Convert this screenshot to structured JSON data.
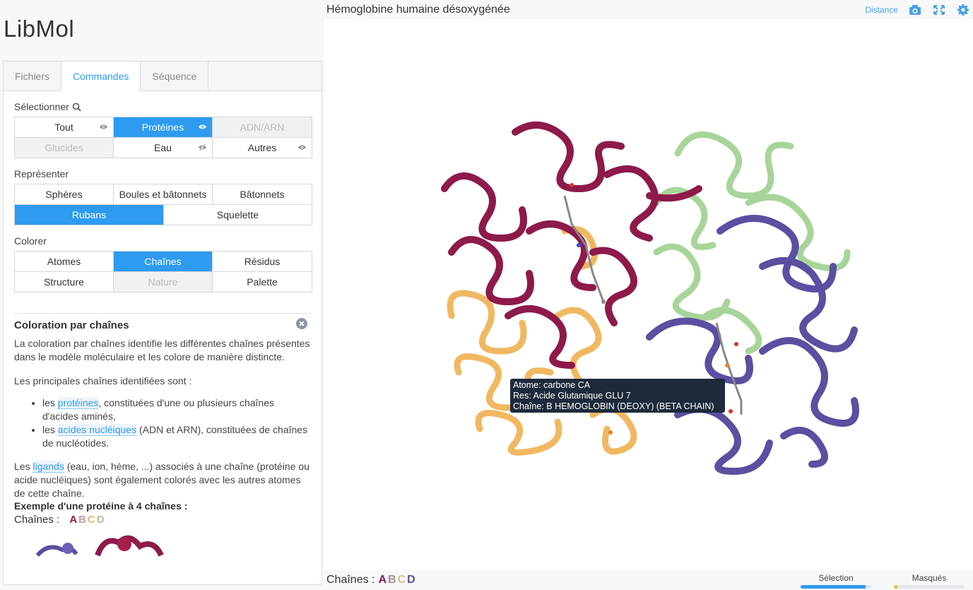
{
  "app": {
    "title": "LibMol"
  },
  "tabs": [
    {
      "label": "Fichiers",
      "active": false
    },
    {
      "label": "Commandes",
      "active": true
    },
    {
      "label": "Séquence",
      "active": false
    }
  ],
  "select": {
    "label": "Sélectionner",
    "items": [
      {
        "label": "Tout",
        "state": "normal",
        "eye": "visible"
      },
      {
        "label": "Protéines",
        "state": "on",
        "eye": "visible"
      },
      {
        "label": "ADN/ARN",
        "state": "off",
        "eye": ""
      },
      {
        "label": "Glucides",
        "state": "off",
        "eye": ""
      },
      {
        "label": "Eau",
        "state": "normal",
        "eye": "hidden"
      },
      {
        "label": "Autres",
        "state": "normal",
        "eye": "visible"
      }
    ]
  },
  "represent": {
    "label": "Représenter",
    "row1": [
      {
        "label": "Sphères",
        "state": "normal"
      },
      {
        "label": "Boules et bâtonnets",
        "state": "normal"
      },
      {
        "label": "Bâtonnets",
        "state": "normal"
      }
    ],
    "row2": [
      {
        "label": "Rubans",
        "state": "on"
      },
      {
        "label": "Squelette",
        "state": "normal"
      }
    ]
  },
  "color": {
    "label": "Colorer",
    "items": [
      {
        "label": "Atomes",
        "state": "normal"
      },
      {
        "label": "Chaînes",
        "state": "on"
      },
      {
        "label": "Résidus",
        "state": "normal"
      },
      {
        "label": "Structure",
        "state": "normal"
      },
      {
        "label": "Nature",
        "state": "off"
      },
      {
        "label": "Palette",
        "state": "normal"
      }
    ]
  },
  "help": {
    "title": "Coloration par chaînes",
    "p1": "La coloration par chaînes identifie les différentes chaînes présentes dans le modèle moléculaire et les colore de manière distincte.",
    "p2": "Les principales chaînes identifiées sont :",
    "li1_pre": "les ",
    "li1_link": "protéines",
    "li1_post": ", constituées d'une ou plusieurs chaînes d'acides aminés,",
    "li2_pre": "les ",
    "li2_link": "acides nucléiques",
    "li2_post": " (ADN et ARN), constituées de chaînes de nucléotides.",
    "p3_pre": "Les ",
    "p3_link": "ligands",
    "p3_post": " (eau, ion, hème, ...) associés à une chaîne (protéine ou acide nucléiques) sont également colorés avec les autres atomes de cette chaîne.",
    "example_title": "Exemple d'une protéine à 4 chaînes :",
    "chains_label": "Chaînes :",
    "chain_letters": [
      "A",
      "B",
      "C",
      "D"
    ]
  },
  "viewer": {
    "title": "Hémoglobine humaine désoxygénée",
    "distance_label": "Distance",
    "tooltip": {
      "line1": "Atome: carbone CA",
      "line2": "Res: Acide Glutamique GLU 7",
      "line3": "Chaîne: B HEMOGLOBIN (DEOXY) (BETA CHAIN)"
    }
  },
  "bottom": {
    "chains_label": "Chaînes :",
    "chain_letters": [
      "A",
      "B",
      "C",
      "D"
    ],
    "selection_label": "Sélection",
    "selection_fraction": 0.92,
    "masked_label": "Masqués",
    "masked_fraction": 0.05
  },
  "colors": {
    "accent": "#2e9bf0",
    "chainA": "#8d1a4a",
    "chainB": "#5a4fa0",
    "chainC": "#f0b860",
    "chainD": "#a8d49a"
  }
}
